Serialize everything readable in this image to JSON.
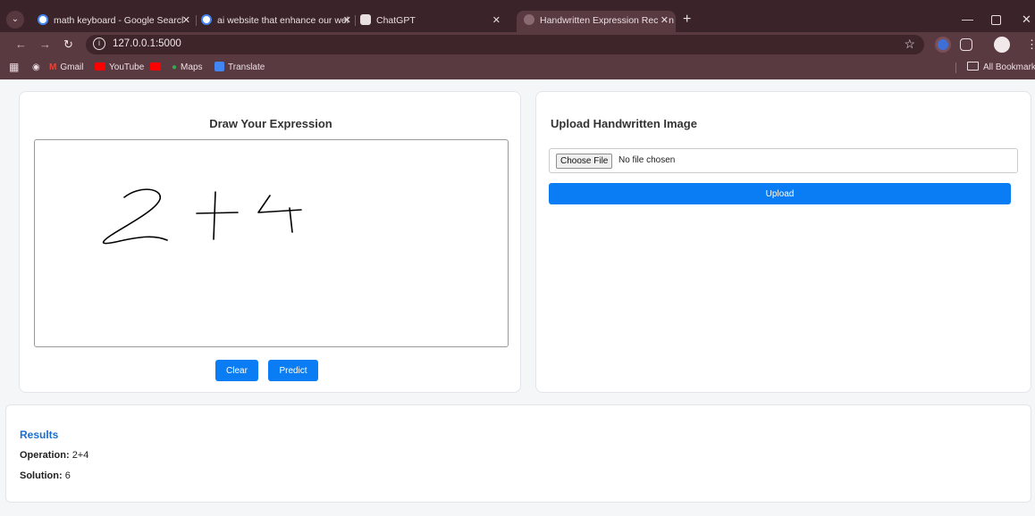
{
  "browser": {
    "tabs": [
      {
        "title": "math keyboard - Google Searcl",
        "favicon": "google-icon"
      },
      {
        "title": "ai website that enhance our wel",
        "favicon": "google-icon"
      },
      {
        "title": "ChatGPT",
        "favicon": "chatgpt-icon"
      },
      {
        "title": "Handwritten Expression Recogn",
        "favicon": "globe-icon",
        "active": true
      }
    ],
    "url": "127.0.0.1:5000",
    "bookmarks": [
      {
        "label": "Gmail",
        "icon": "gmail-icon"
      },
      {
        "label": "YouTube",
        "icon": "youtube-icon"
      },
      {
        "label": "Maps",
        "icon": "maps-icon"
      },
      {
        "label": "Translate",
        "icon": "translate-icon"
      }
    ],
    "all_bookmarks": "All Bookmarks"
  },
  "draw": {
    "title": "Draw Your Expression",
    "clear_label": "Clear",
    "predict_label": "Predict"
  },
  "upload": {
    "title": "Upload Handwritten Image",
    "choose_label": "Choose File",
    "file_status": "No file chosen",
    "upload_label": "Upload"
  },
  "results": {
    "title": "Results",
    "operation_label": "Operation:",
    "operation_value": "2+4",
    "solution_label": "Solution:",
    "solution_value": "6"
  },
  "colors": {
    "accent": "#0a7df4",
    "results_title": "#1a6fd0",
    "chrome": "#5a3a41"
  }
}
